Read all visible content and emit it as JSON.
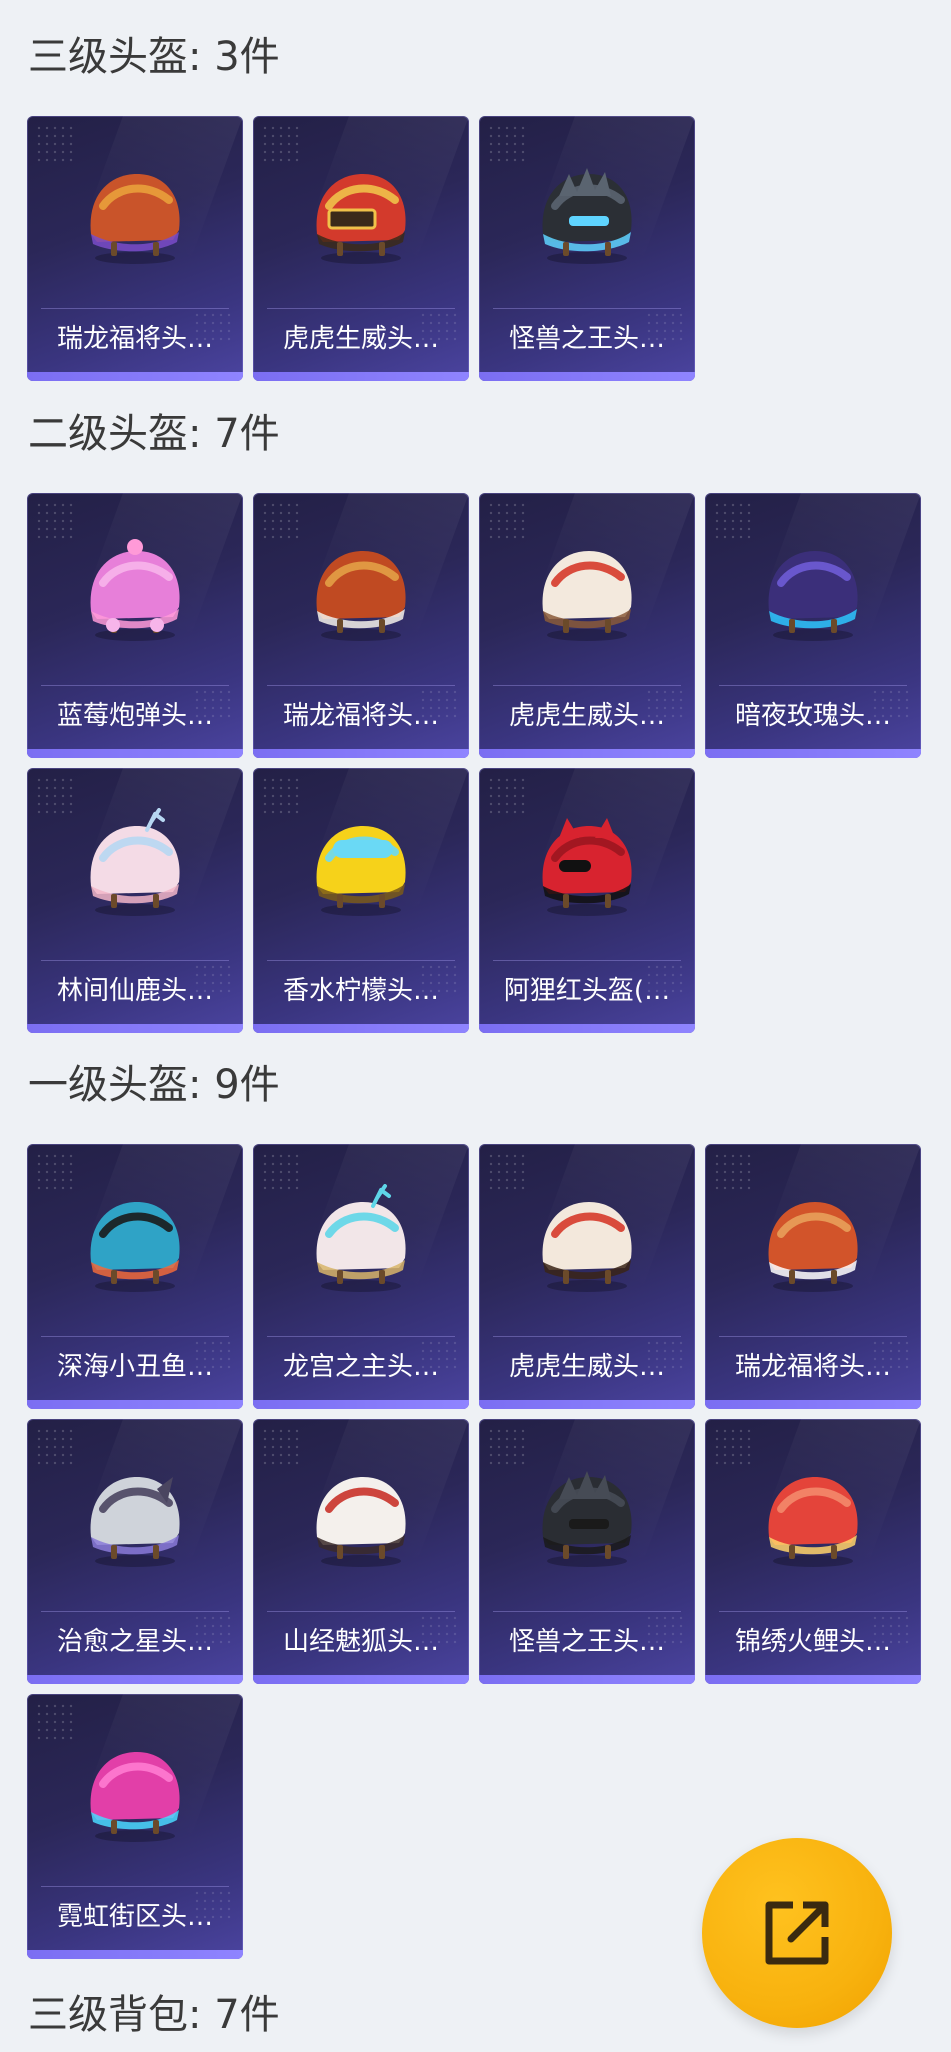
{
  "sections": [
    {
      "title": "三级头盔: 3件",
      "items": [
        {
          "label": "瑞龙福将头…",
          "icon": "helmet-dragon-gold-icon",
          "colors": [
            "#c9542a",
            "#e9a03b",
            "#7a4cc9"
          ]
        },
        {
          "label": "虎虎生威头…",
          "icon": "helmet-tiger-red-icon",
          "colors": [
            "#d33a2c",
            "#f0c24a",
            "#3b2a1a"
          ]
        },
        {
          "label": "怪兽之王头…",
          "icon": "helmet-godzilla-icon",
          "colors": [
            "#2b2f35",
            "#5a6470",
            "#5fd4ff"
          ]
        }
      ]
    },
    {
      "title": "二级头盔: 7件",
      "items": [
        {
          "label": "蓝莓炮弹头…",
          "icon": "helmet-pink-cute-icon",
          "colors": [
            "#e77fd9",
            "#f7b5ea",
            "#ff9ad8"
          ]
        },
        {
          "label": "瑞龙福将头…",
          "icon": "helmet-dragon-red-icon",
          "colors": [
            "#c04a22",
            "#e3a046",
            "#f4f1ea"
          ]
        },
        {
          "label": "虎虎生威头…",
          "icon": "helmet-tiger-white-icon",
          "colors": [
            "#f3e9dd",
            "#d63a2a",
            "#8a5a3a"
          ]
        },
        {
          "label": "暗夜玫瑰头…",
          "icon": "helmet-night-rose-icon",
          "colors": [
            "#3b2f7a",
            "#6f5cd6",
            "#2ec7ff"
          ]
        },
        {
          "label": "林间仙鹿头…",
          "icon": "helmet-forest-deer-icon",
          "colors": [
            "#f4dbe6",
            "#b7d7f2",
            "#f2b6c8"
          ]
        },
        {
          "label": "香水柠檬头…",
          "icon": "helmet-lemon-icon",
          "colors": [
            "#f6d21a",
            "#6ad9f5",
            "#7a5a1a"
          ]
        },
        {
          "label": "阿狸红头盔(…",
          "icon": "helmet-fox-red-icon",
          "colors": [
            "#d8232f",
            "#9c1620",
            "#111111"
          ]
        }
      ]
    },
    {
      "title": "一级头盔: 9件",
      "items": [
        {
          "label": "深海小丑鱼…",
          "icon": "helmet-clownfish-icon",
          "colors": [
            "#2fa3c6",
            "#1b1b1b",
            "#f06a3b"
          ]
        },
        {
          "label": "龙宫之主头…",
          "icon": "helmet-dragon-palace-icon",
          "colors": [
            "#f2e6e8",
            "#5fd6e8",
            "#d8b56a"
          ]
        },
        {
          "label": "虎虎生威头…",
          "icon": "helmet-tiger-open-icon",
          "colors": [
            "#f3e8dc",
            "#d63a2a",
            "#3a2418"
          ]
        },
        {
          "label": "瑞龙福将头…",
          "icon": "helmet-dragon-open-icon",
          "colors": [
            "#d2542a",
            "#e8a05a",
            "#ffffff"
          ]
        },
        {
          "label": "治愈之星头…",
          "icon": "helmet-star-mech-icon",
          "colors": [
            "#cfd3da",
            "#4a4560",
            "#8a7ad8"
          ]
        },
        {
          "label": "山经魅狐头…",
          "icon": "helmet-fox-white-icon",
          "colors": [
            "#f4f0ec",
            "#c9322a",
            "#3a2a2a"
          ]
        },
        {
          "label": "怪兽之王头…",
          "icon": "helmet-monster-black-icon",
          "colors": [
            "#2a2d33",
            "#464b55",
            "#1a1a1a"
          ]
        },
        {
          "label": "锦绣火鲤头…",
          "icon": "helmet-koi-red-icon",
          "colors": [
            "#e4443a",
            "#f38a6b",
            "#ffd36a"
          ]
        },
        {
          "label": "霓虹街区头…",
          "icon": "helmet-neon-pink-icon",
          "colors": [
            "#e23fa8",
            "#ff7bd0",
            "#4ad9ff"
          ]
        }
      ]
    },
    {
      "title": "三级背包: 7件",
      "items": []
    }
  ],
  "fab": {
    "icon": "share-external-icon",
    "color": "#f8b20e"
  }
}
